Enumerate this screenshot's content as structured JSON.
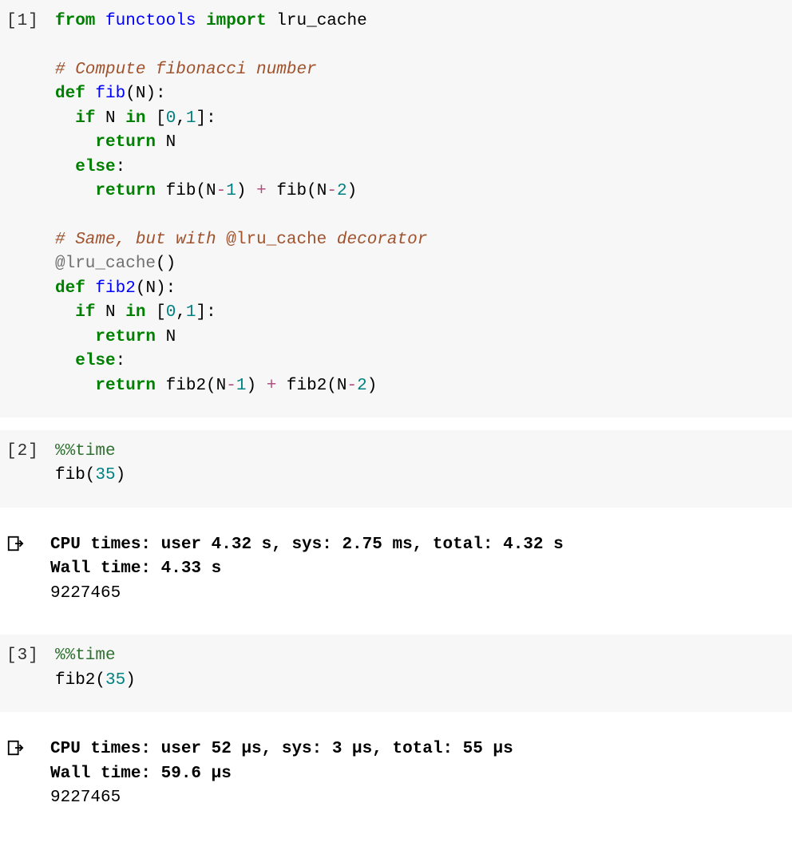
{
  "cells": [
    {
      "prompt": "[1]",
      "type": "input",
      "tokens": [
        {
          "t": "from",
          "c": "kw"
        },
        {
          "t": " ",
          "c": "plain"
        },
        {
          "t": "functools",
          "c": "nm"
        },
        {
          "t": " ",
          "c": "plain"
        },
        {
          "t": "import",
          "c": "kw"
        },
        {
          "t": " ",
          "c": "plain"
        },
        {
          "t": "lru_cache",
          "c": "plain"
        },
        {
          "t": "\n\n",
          "c": "plain"
        },
        {
          "t": "# Compute fibonacci number",
          "c": "cm-ital"
        },
        {
          "t": "\n",
          "c": "plain"
        },
        {
          "t": "def",
          "c": "kw"
        },
        {
          "t": " ",
          "c": "plain"
        },
        {
          "t": "fib",
          "c": "fn"
        },
        {
          "t": "(N):",
          "c": "plain"
        },
        {
          "t": "\n",
          "c": "plain"
        },
        {
          "t": "  ",
          "c": "plain"
        },
        {
          "t": "if",
          "c": "kw"
        },
        {
          "t": " N ",
          "c": "plain"
        },
        {
          "t": "in",
          "c": "kw"
        },
        {
          "t": " [",
          "c": "plain"
        },
        {
          "t": "0",
          "c": "num"
        },
        {
          "t": ",",
          "c": "plain"
        },
        {
          "t": "1",
          "c": "num"
        },
        {
          "t": "]:",
          "c": "plain"
        },
        {
          "t": "\n",
          "c": "plain"
        },
        {
          "t": "    ",
          "c": "plain"
        },
        {
          "t": "return",
          "c": "kw"
        },
        {
          "t": " N",
          "c": "plain"
        },
        {
          "t": "\n",
          "c": "plain"
        },
        {
          "t": "  ",
          "c": "plain"
        },
        {
          "t": "else",
          "c": "kw"
        },
        {
          "t": ":",
          "c": "plain"
        },
        {
          "t": "\n",
          "c": "plain"
        },
        {
          "t": "    ",
          "c": "plain"
        },
        {
          "t": "return",
          "c": "kw"
        },
        {
          "t": " fib(N",
          "c": "plain"
        },
        {
          "t": "-",
          "c": "op"
        },
        {
          "t": "1",
          "c": "num"
        },
        {
          "t": ") ",
          "c": "plain"
        },
        {
          "t": "+",
          "c": "op"
        },
        {
          "t": " fib(N",
          "c": "plain"
        },
        {
          "t": "-",
          "c": "op"
        },
        {
          "t": "2",
          "c": "num"
        },
        {
          "t": ")",
          "c": "plain"
        },
        {
          "t": "\n\n",
          "c": "plain"
        },
        {
          "t": "# Same, but with ",
          "c": "cm-ital"
        },
        {
          "t": "@lru_cache",
          "c": "cm"
        },
        {
          "t": " decorator",
          "c": "cm-ital"
        },
        {
          "t": "\n",
          "c": "plain"
        },
        {
          "t": "@lru_cache",
          "c": "dec"
        },
        {
          "t": "()",
          "c": "plain"
        },
        {
          "t": "\n",
          "c": "plain"
        },
        {
          "t": "def",
          "c": "kw"
        },
        {
          "t": " ",
          "c": "plain"
        },
        {
          "t": "fib2",
          "c": "fn"
        },
        {
          "t": "(N):",
          "c": "plain"
        },
        {
          "t": "\n",
          "c": "plain"
        },
        {
          "t": "  ",
          "c": "plain"
        },
        {
          "t": "if",
          "c": "kw"
        },
        {
          "t": " N ",
          "c": "plain"
        },
        {
          "t": "in",
          "c": "kw"
        },
        {
          "t": " [",
          "c": "plain"
        },
        {
          "t": "0",
          "c": "num"
        },
        {
          "t": ",",
          "c": "plain"
        },
        {
          "t": "1",
          "c": "num"
        },
        {
          "t": "]:",
          "c": "plain"
        },
        {
          "t": "\n",
          "c": "plain"
        },
        {
          "t": "    ",
          "c": "plain"
        },
        {
          "t": "return",
          "c": "kw"
        },
        {
          "t": " N",
          "c": "plain"
        },
        {
          "t": "\n",
          "c": "plain"
        },
        {
          "t": "  ",
          "c": "plain"
        },
        {
          "t": "else",
          "c": "kw"
        },
        {
          "t": ":",
          "c": "plain"
        },
        {
          "t": "\n",
          "c": "plain"
        },
        {
          "t": "    ",
          "c": "plain"
        },
        {
          "t": "return",
          "c": "kw"
        },
        {
          "t": " fib2(N",
          "c": "plain"
        },
        {
          "t": "-",
          "c": "op"
        },
        {
          "t": "1",
          "c": "num"
        },
        {
          "t": ") ",
          "c": "plain"
        },
        {
          "t": "+",
          "c": "op"
        },
        {
          "t": " fib2(N",
          "c": "plain"
        },
        {
          "t": "-",
          "c": "op"
        },
        {
          "t": "2",
          "c": "num"
        },
        {
          "t": ")",
          "c": "plain"
        }
      ]
    },
    {
      "prompt": "[2]",
      "type": "input",
      "tokens": [
        {
          "t": "%%time",
          "c": "mg"
        },
        {
          "t": "\n",
          "c": "plain"
        },
        {
          "t": "fib(",
          "c": "plain"
        },
        {
          "t": "35",
          "c": "num"
        },
        {
          "t": ")",
          "c": "plain"
        }
      ]
    },
    {
      "type": "output",
      "tokens": [
        {
          "t": "CPU times: user 4.32 s, sys: 2.75 ms, total: 4.32 s\nWall time: 4.33 s\n",
          "c": "plain bold"
        },
        {
          "t": "9227465",
          "c": "plain"
        }
      ]
    },
    {
      "prompt": "[3]",
      "type": "input",
      "tokens": [
        {
          "t": "%%time",
          "c": "mg"
        },
        {
          "t": "\n",
          "c": "plain"
        },
        {
          "t": "fib2(",
          "c": "plain"
        },
        {
          "t": "35",
          "c": "num"
        },
        {
          "t": ")",
          "c": "plain"
        }
      ]
    },
    {
      "type": "output",
      "tokens": [
        {
          "t": "CPU times: user 52 µs, sys: 3 µs, total: 55 µs\nWall time: 59.6 µs\n",
          "c": "plain bold"
        },
        {
          "t": "9227465",
          "c": "plain"
        }
      ]
    }
  ]
}
